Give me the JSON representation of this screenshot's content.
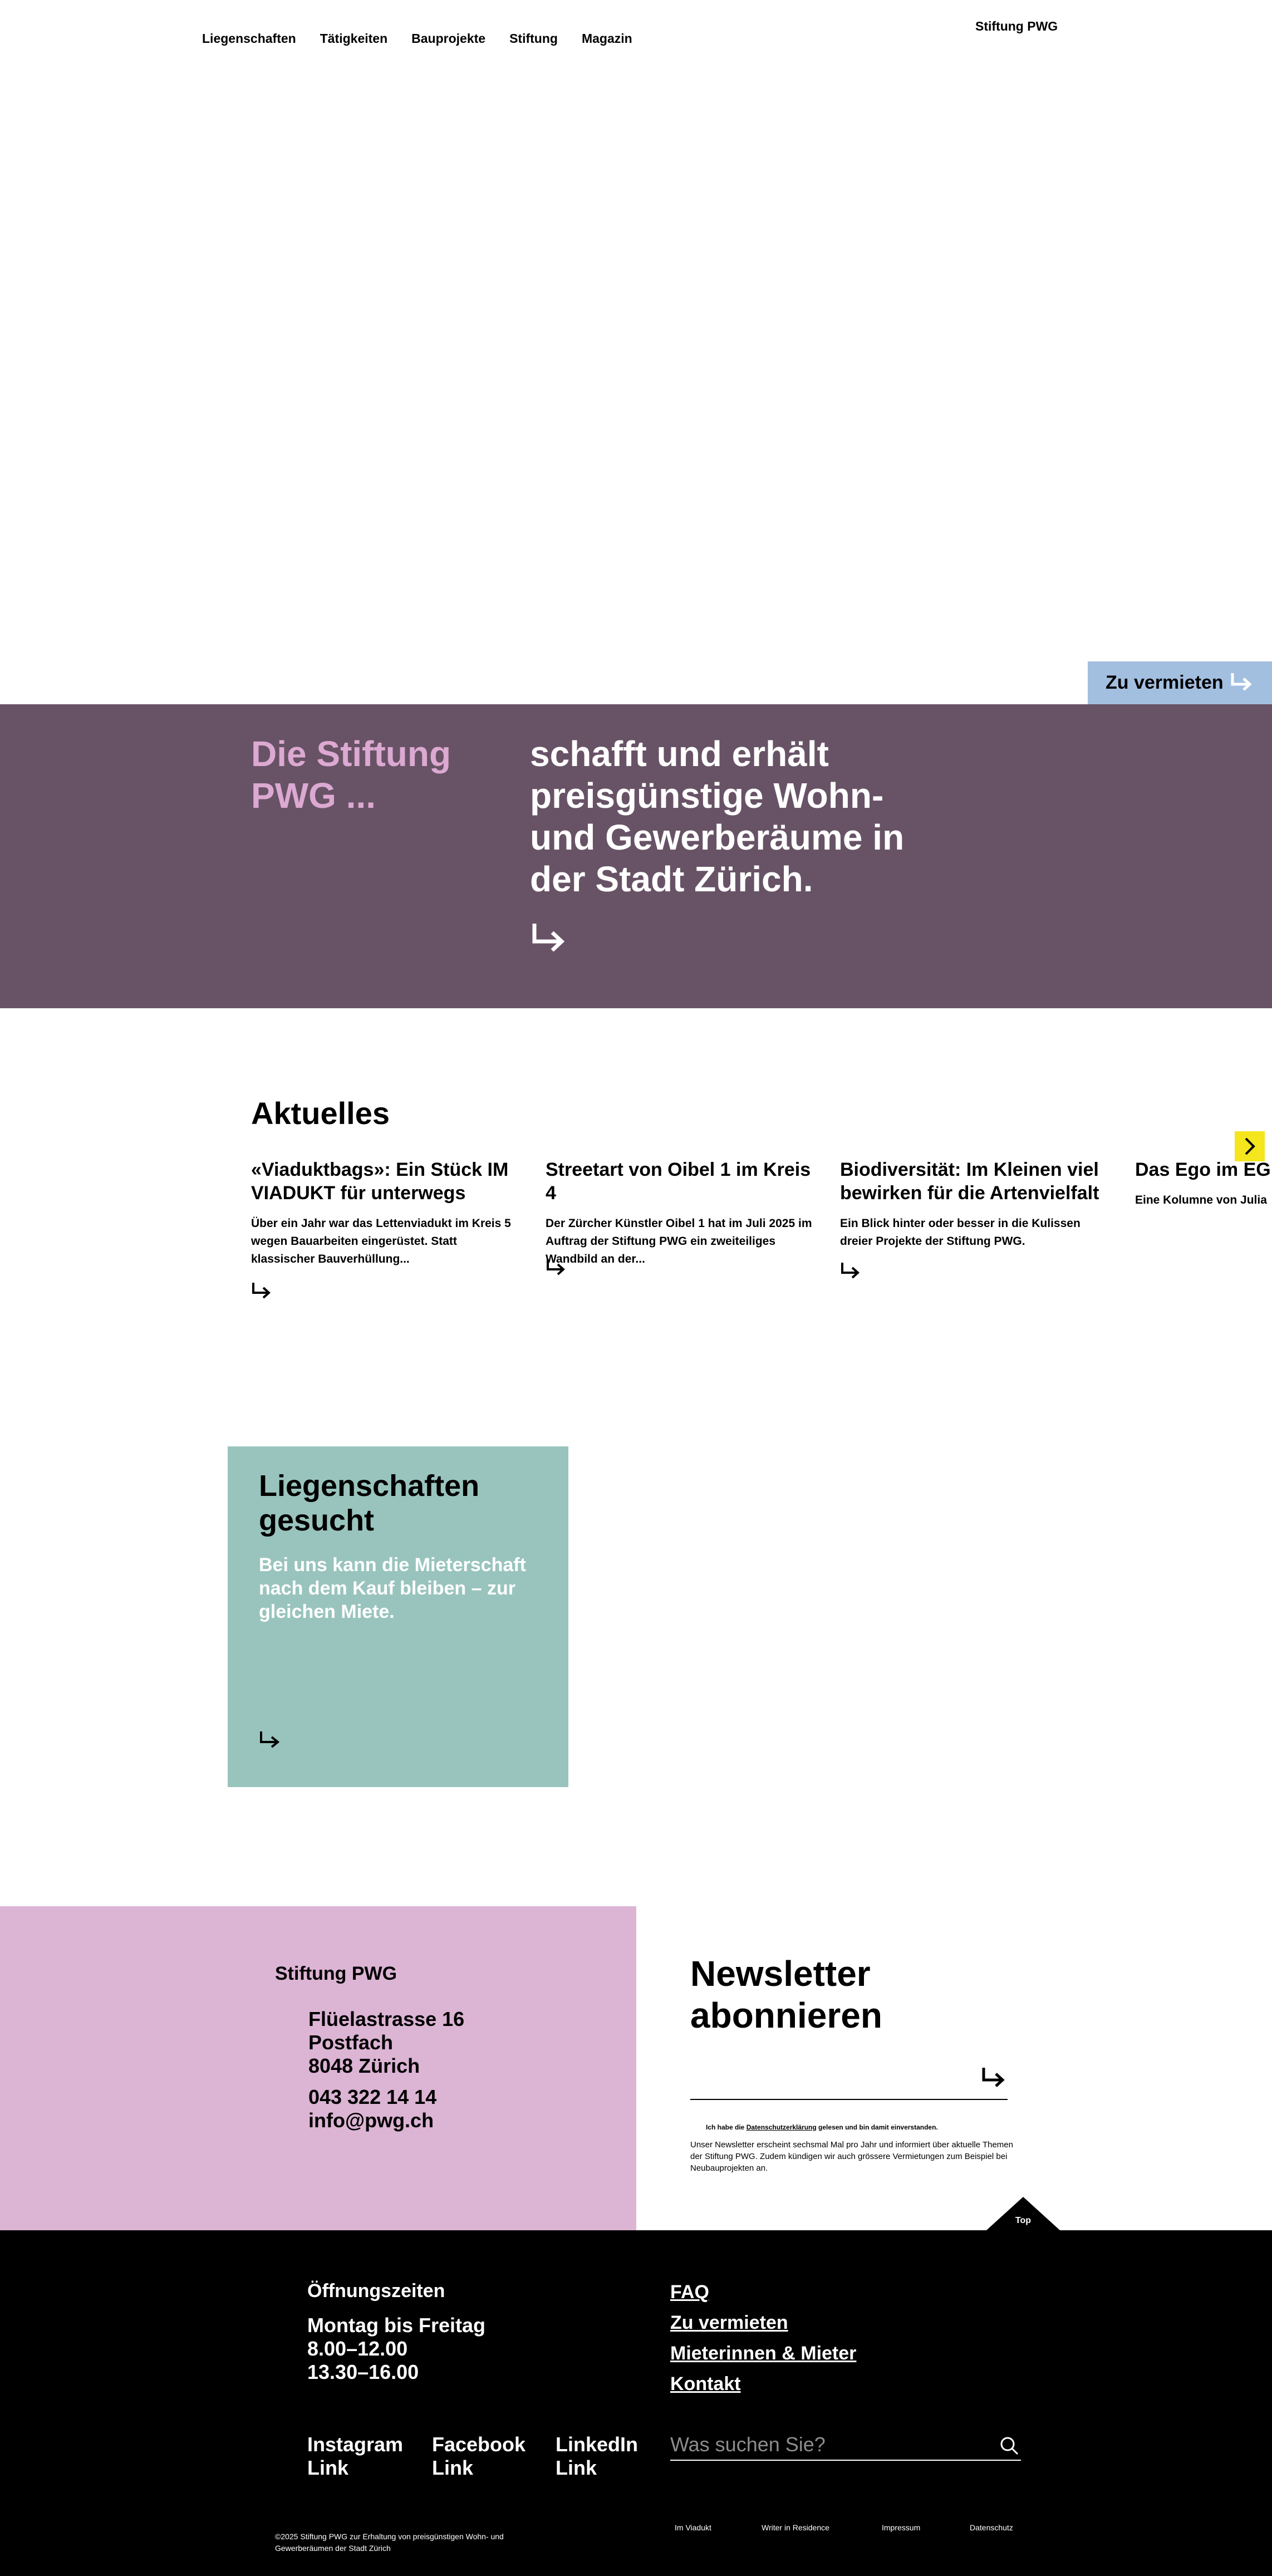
{
  "header": {
    "nav": [
      "Liegenschaften",
      "Tätigkeiten",
      "Bauprojekte",
      "Stiftung",
      "Magazin"
    ],
    "brand": "Stiftung PWG"
  },
  "rent_tab": {
    "label": "Zu vermieten"
  },
  "mission": {
    "left": "Die Stiftung PWG ...",
    "right": "schafft und erhält preisgünstige Wohn- und Gewerberäume in der Stadt Zürich."
  },
  "news": {
    "title": "Aktuelles",
    "items": [
      {
        "title": "«Viaduktbags»: Ein Stück IM VIADUKT für unterwegs",
        "teaser": "Über ein Jahr war das Lettenviadukt im Kreis 5 wegen Bauarbeiten eingerüstet. Statt klassischer Bauverhüllung..."
      },
      {
        "title": "Streetart von Oibel 1 im Kreis 4",
        "teaser": "Der Zürcher Künstler Oibel 1 hat im Juli 2025 im Auftrag der Stiftung PWG ein zweiteiliges Wandbild an der..."
      },
      {
        "title": "Biodiversität: Im Kleinen viel bewirken für die Artenvielfalt",
        "teaser": "Ein Blick hinter oder besser in die Kulissen dreier Projekte der Stiftung PWG."
      },
      {
        "title": "Das Ego im EG",
        "teaser": "Eine Kolumne von Julia"
      }
    ]
  },
  "lieg": {
    "title": "Liegenschaften gesucht",
    "text": "Bei uns kann die Mieterschaft nach dem Kauf bleiben – zur gleichen Miete."
  },
  "contact": {
    "org": "Stiftung PWG",
    "address": [
      "Flüelastrasse 16",
      "Postfach",
      "8048 Zürich"
    ],
    "phone": "043 322 14 14",
    "email": "info@pwg.ch"
  },
  "newsletter": {
    "title": "Newsletter abonnieren",
    "consent_pre": "Ich habe die ",
    "consent_link": "Datenschutzerklärung",
    "consent_post": " gelesen und bin damit einverstanden.",
    "info": "Unser Newsletter erscheint sechsmal Mal pro Jahr und informiert über aktuelle Themen der Stiftung PWG. Zudem kündigen wir auch grössere Vermietungen zum Beispiel bei Neubauprojekten an."
  },
  "top_button": "Top",
  "footer": {
    "hours_title": "Öffnungszeiten",
    "hours_days": "Montag bis Freitag",
    "hours_1": "8.00–12.00",
    "hours_2": "13.30–16.00",
    "links": [
      "FAQ",
      "Zu vermieten",
      "Mieterinnen & Mieter",
      "Kontakt"
    ],
    "social": [
      {
        "name": "Instagram",
        "link": "Link"
      },
      {
        "name": "Facebook",
        "link": "Link"
      },
      {
        "name": "LinkedIn",
        "link": "Link"
      }
    ],
    "search_placeholder": "Was suchen Sie?",
    "copyright": "©2025 Stiftung PWG zur Erhaltung von preisgünstigen Wohn- und Gewerberäumen der Stadt Zürich",
    "legal": [
      "Im Viadukt",
      "Writer in Residence",
      "Impressum",
      "Datenschutz"
    ]
  },
  "colors": {
    "mission_bg": "#685366",
    "mission_accent": "#dca9d2",
    "rent_tab_bg": "#a3bfe0",
    "next_button": "#f4e51d",
    "lieg_bg": "#99c4bd",
    "contact_bg": "#dcb4d4",
    "footer_bg": "#000000"
  }
}
